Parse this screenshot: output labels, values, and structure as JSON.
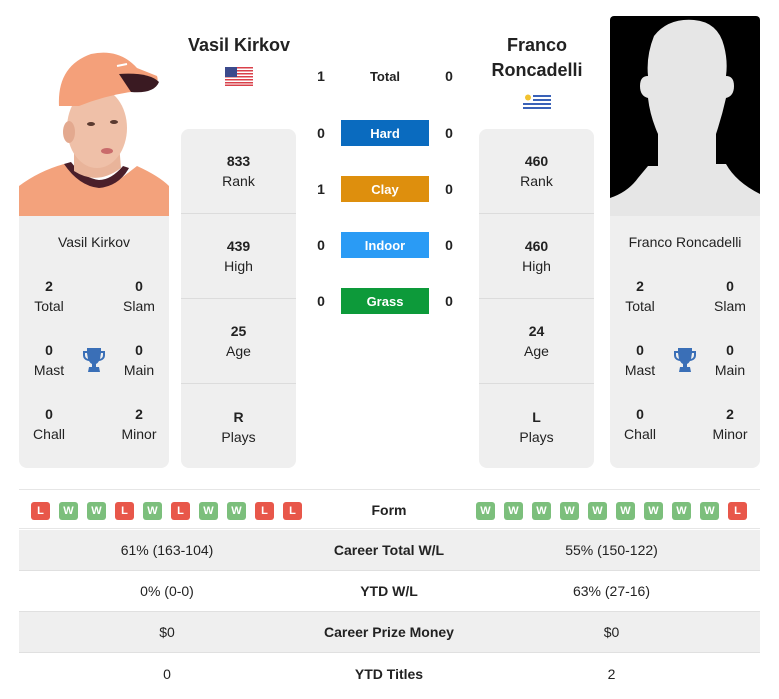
{
  "player_left": {
    "name": "Vasil Kirkov",
    "country_flag": "usa-flag",
    "rank": "833",
    "rank_label": "Rank",
    "high": "439",
    "high_label": "High",
    "age": "25",
    "age_label": "Age",
    "plays": "R",
    "plays_label": "Plays",
    "titles": {
      "total": "2",
      "total_label": "Total",
      "slam": "0",
      "slam_label": "Slam",
      "mast": "0",
      "mast_label": "Mast",
      "main": "0",
      "main_label": "Main",
      "chall": "0",
      "chall_label": "Chall",
      "minor": "2",
      "minor_label": "Minor"
    },
    "form": [
      "L",
      "W",
      "W",
      "L",
      "W",
      "L",
      "W",
      "W",
      "L",
      "L"
    ]
  },
  "player_right": {
    "name_line1": "Franco",
    "name_line2": "Roncadelli",
    "name": "Franco Roncadelli",
    "country_flag": "uruguay-flag",
    "rank": "460",
    "rank_label": "Rank",
    "high": "460",
    "high_label": "High",
    "age": "24",
    "age_label": "Age",
    "plays": "L",
    "plays_label": "Plays",
    "titles": {
      "total": "2",
      "total_label": "Total",
      "slam": "0",
      "slam_label": "Slam",
      "mast": "0",
      "mast_label": "Mast",
      "main": "0",
      "main_label": "Main",
      "chall": "0",
      "chall_label": "Chall",
      "minor": "2",
      "minor_label": "Minor"
    },
    "form": [
      "W",
      "W",
      "W",
      "W",
      "W",
      "W",
      "W",
      "W",
      "W",
      "L"
    ]
  },
  "h2h": [
    {
      "label": "Total",
      "left": "1",
      "right": "0",
      "color": null
    },
    {
      "label": "Hard",
      "left": "0",
      "right": "0",
      "color": "#0a6bbf"
    },
    {
      "label": "Clay",
      "left": "1",
      "right": "0",
      "color": "#de8f0d"
    },
    {
      "label": "Indoor",
      "left": "0",
      "right": "0",
      "color": "#2a9bf5"
    },
    {
      "label": "Grass",
      "left": "0",
      "right": "0",
      "color": "#0d9a3a"
    }
  ],
  "form_label": "Form",
  "comparison": [
    {
      "label": "Career Total W/L",
      "left": "61% (163-104)",
      "right": "55% (150-122)"
    },
    {
      "label": "YTD W/L",
      "left": "0% (0-0)",
      "right": "63% (27-16)"
    },
    {
      "label": "Career Prize Money",
      "left": "$0",
      "right": "$0"
    },
    {
      "label": "YTD Titles",
      "left": "0",
      "right": "2"
    }
  ],
  "colors": {
    "win": "#7cbf7c",
    "loss": "#e8574a",
    "trophy": "#3a6fb7",
    "card_bg": "#efefef"
  }
}
